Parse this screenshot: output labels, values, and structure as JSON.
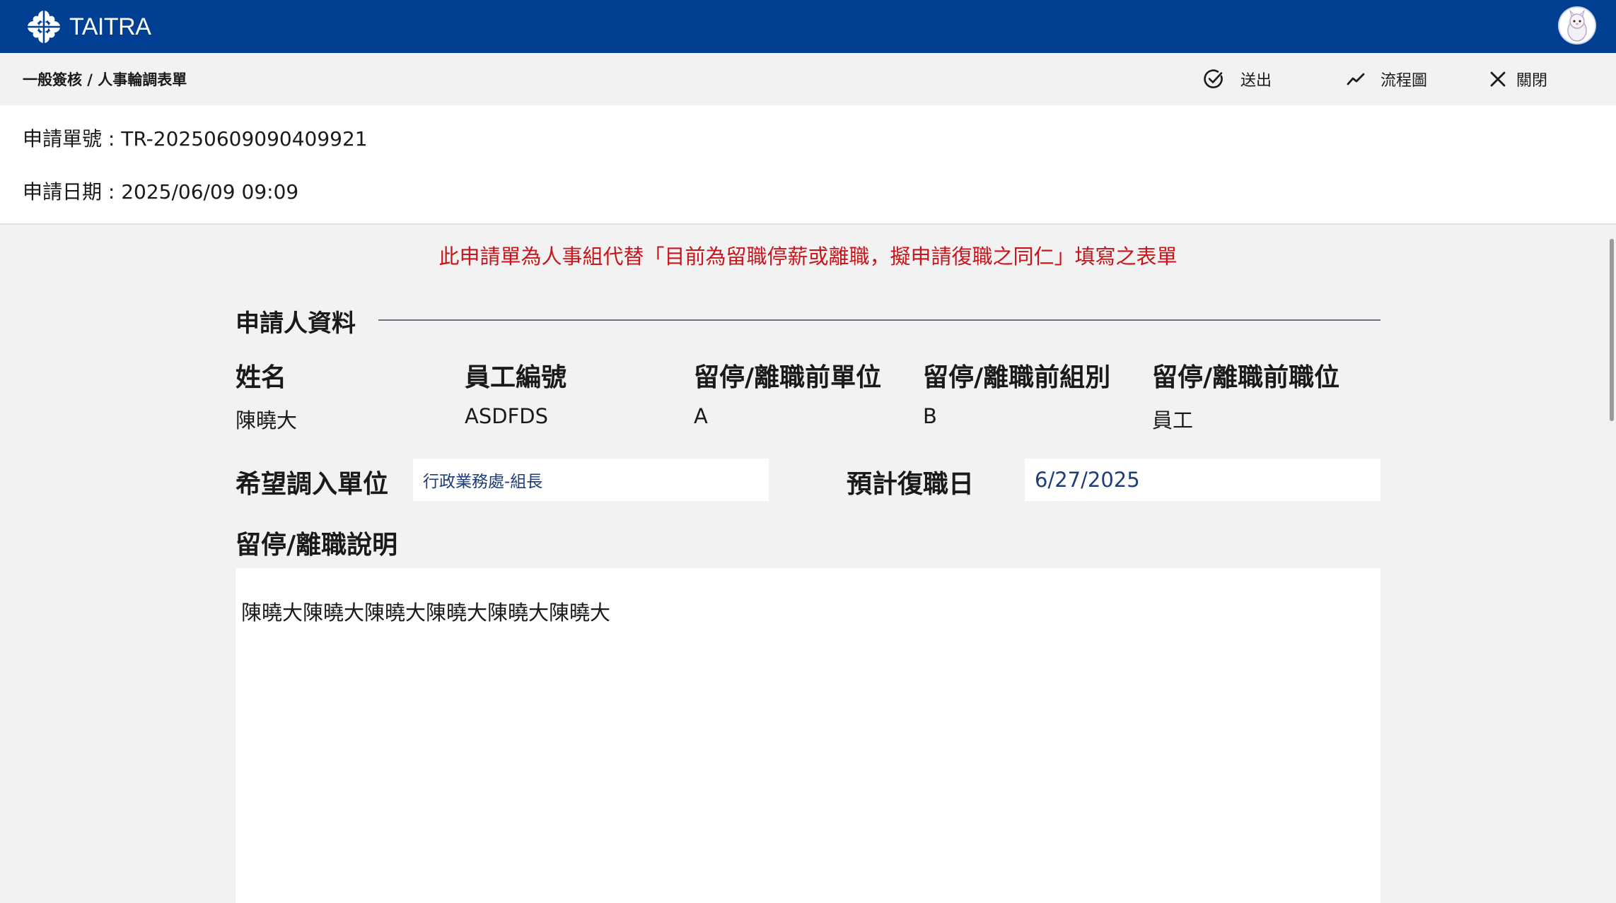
{
  "header": {
    "logo_text": "TAITRA"
  },
  "toolbar": {
    "breadcrumb": "一般簽核 / 人事輪調表單",
    "submit_label": "送出",
    "flowchart_label": "流程圖",
    "close_label": "關閉"
  },
  "info": {
    "application_no": "申請單號 : TR-20250609090409921",
    "application_date": "申請日期 : 2025/06/09 09:09"
  },
  "notice": "此申請單為人事組代替「目前為留職停薪或離職，擬申請復職之同仁」填寫之表單",
  "applicant": {
    "section_title": "申請人資料",
    "columns": [
      {
        "label": "姓名",
        "value": "陳曉大"
      },
      {
        "label": "員工編號",
        "value": "ASDFDS"
      },
      {
        "label": "留停/離職前單位",
        "value": "A"
      },
      {
        "label": "留停/離職前組別",
        "value": "B"
      },
      {
        "label": "留停/離職前職位",
        "value": "員工"
      }
    ]
  },
  "form": {
    "target_unit_label": "希望調入單位",
    "target_unit_value": "行政業務處-組長",
    "return_date_label": "預計復職日",
    "return_date_value": "6/27/2025",
    "explanation_label": "留停/離職說明",
    "explanation_value": "陳曉大陳曉大陳曉大陳曉大陳曉大陳曉大"
  },
  "colors": {
    "header_bg": "#003f91",
    "notice_red": "#c8161d",
    "field_text": "#1f3d7a"
  },
  "icons": [
    "taitra-logo",
    "user-avatar",
    "check-circle-icon",
    "trend-line-icon",
    "close-icon"
  ]
}
